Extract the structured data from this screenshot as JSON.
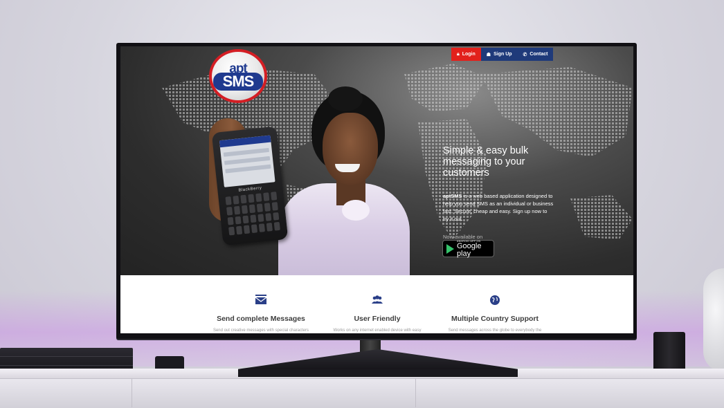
{
  "site": {
    "logo": {
      "top": "apt",
      "bottom": "SMS"
    }
  },
  "top_nav": [
    {
      "label": "Login",
      "icon": "lock-icon"
    },
    {
      "label": "Sign Up",
      "icon": "user-icon"
    },
    {
      "label": "Contact",
      "icon": "phone-icon"
    }
  ],
  "hero": {
    "headline": "Simple & easy bulk messaging to your customers",
    "brand_name": "aptSMS",
    "body": "is a web based application designed to help you send SMS as an individual or business fast. Secure, cheap and easy. Sign up now to try it out.",
    "available_label": "Now available on",
    "store_badge": {
      "small": "ANDROID APP ON",
      "big": "Google play"
    },
    "phone_brand": "BlackBerry"
  },
  "features": [
    {
      "icon": "envelope-icon",
      "title": "Send complete Messages",
      "desc": "Send out creative messages with special characters"
    },
    {
      "icon": "users-icon",
      "title": "User Friendly",
      "desc": "Works on any internet enabled device with easy"
    },
    {
      "icon": "globe-icon",
      "title": "Multiple Country Support",
      "desc": "Send messages across the globe to everybody the"
    }
  ],
  "colors": {
    "accent_red": "#e2211c",
    "nav_blue": "#1f3a7a",
    "icon_blue": "#2a3f88",
    "hero_dark": "#2d2d2d"
  }
}
